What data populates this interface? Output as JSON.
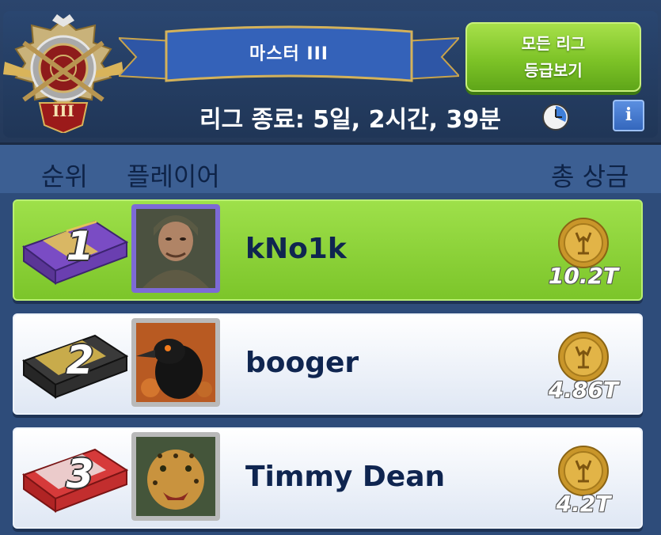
{
  "header": {
    "league_name": "마스터 III",
    "emblem_rank": "III",
    "all_leagues_button": [
      "모든 리그",
      "등급보기"
    ],
    "timer_text": "리그 종료: 5일, 2시간, 39분",
    "info_label": "i"
  },
  "columns": {
    "rank": "순위",
    "player": "플레이어",
    "prize": "총 상금"
  },
  "rows": [
    {
      "rank": "1",
      "name": "kNo1k",
      "prize": "10.2T",
      "crate": "purple",
      "avatar": "soldier-avatar"
    },
    {
      "rank": "2",
      "name": "booger",
      "prize": "4.86T",
      "crate": "black-gold",
      "avatar": "crow-avatar"
    },
    {
      "rank": "3",
      "name": "Timmy Dean",
      "prize": "4.2T",
      "crate": "red",
      "avatar": "leopard-avatar"
    }
  ],
  "colors": {
    "highlight_row": "#8fd23c",
    "button_green": "#7dc327",
    "background": "#3c5f93",
    "text_dark": "#0f2550"
  }
}
